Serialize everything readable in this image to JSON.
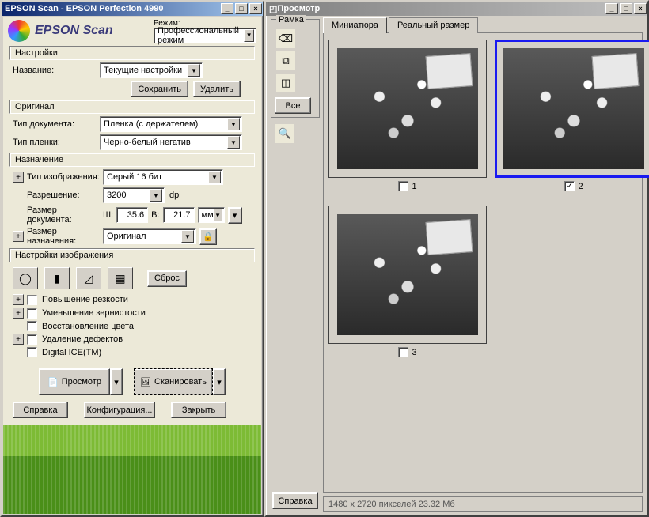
{
  "main": {
    "title": "EPSON Scan - EPSON Perfection 4990",
    "logo": "EPSON Scan",
    "mode_label": "Режим:",
    "mode_value": "Профессиональный режим",
    "settings_group": "Настройки",
    "name_label": "Название:",
    "name_value": "Текущие настройки",
    "save_btn": "Сохранить",
    "delete_btn": "Удалить",
    "original_group": "Оригинал",
    "doc_type_label": "Тип документа:",
    "doc_type_value": "Пленка (с держателем)",
    "film_type_label": "Тип пленки:",
    "film_type_value": "Черно-белый негатив",
    "dest_group": "Назначение",
    "img_type_label": "Тип изображения:",
    "img_type_value": "Серый 16 бит",
    "resolution_label": "Разрешение:",
    "resolution_value": "3200",
    "dpi": "dpi",
    "doc_size_label": "Размер документа:",
    "w_label": "Ш:",
    "w_value": "35.6",
    "h_label": "В:",
    "h_value": "21.7",
    "unit": "мм",
    "target_size_label": "Размер назначения:",
    "target_size_value": "Оригинал",
    "img_settings_group": "Настройки изображения",
    "reset_btn": "Сброс",
    "sharpen": "Повышение резкости",
    "grain": "Уменьшение зернистости",
    "color_restore": "Восстановление цвета",
    "defect": "Удаление дефектов",
    "digital_ice": "Digital ICE(TM)",
    "preview_btn": "Просмотр",
    "scan_btn": "Сканировать",
    "help_btn": "Справка",
    "config_btn": "Конфигурация...",
    "close_btn": "Закрыть"
  },
  "preview": {
    "title": "Просмотр",
    "frame_group": "Рамка",
    "all_btn": "Все",
    "tab_thumb": "Миниатюра",
    "tab_real": "Реальный размер",
    "thumbs": [
      {
        "num": "1",
        "checked": false
      },
      {
        "num": "2",
        "checked": true,
        "selected": true
      },
      {
        "num": "3",
        "checked": false
      }
    ],
    "help_btn": "Справка",
    "status": "1480 x 2720 пикселей 23.32 Мб"
  }
}
